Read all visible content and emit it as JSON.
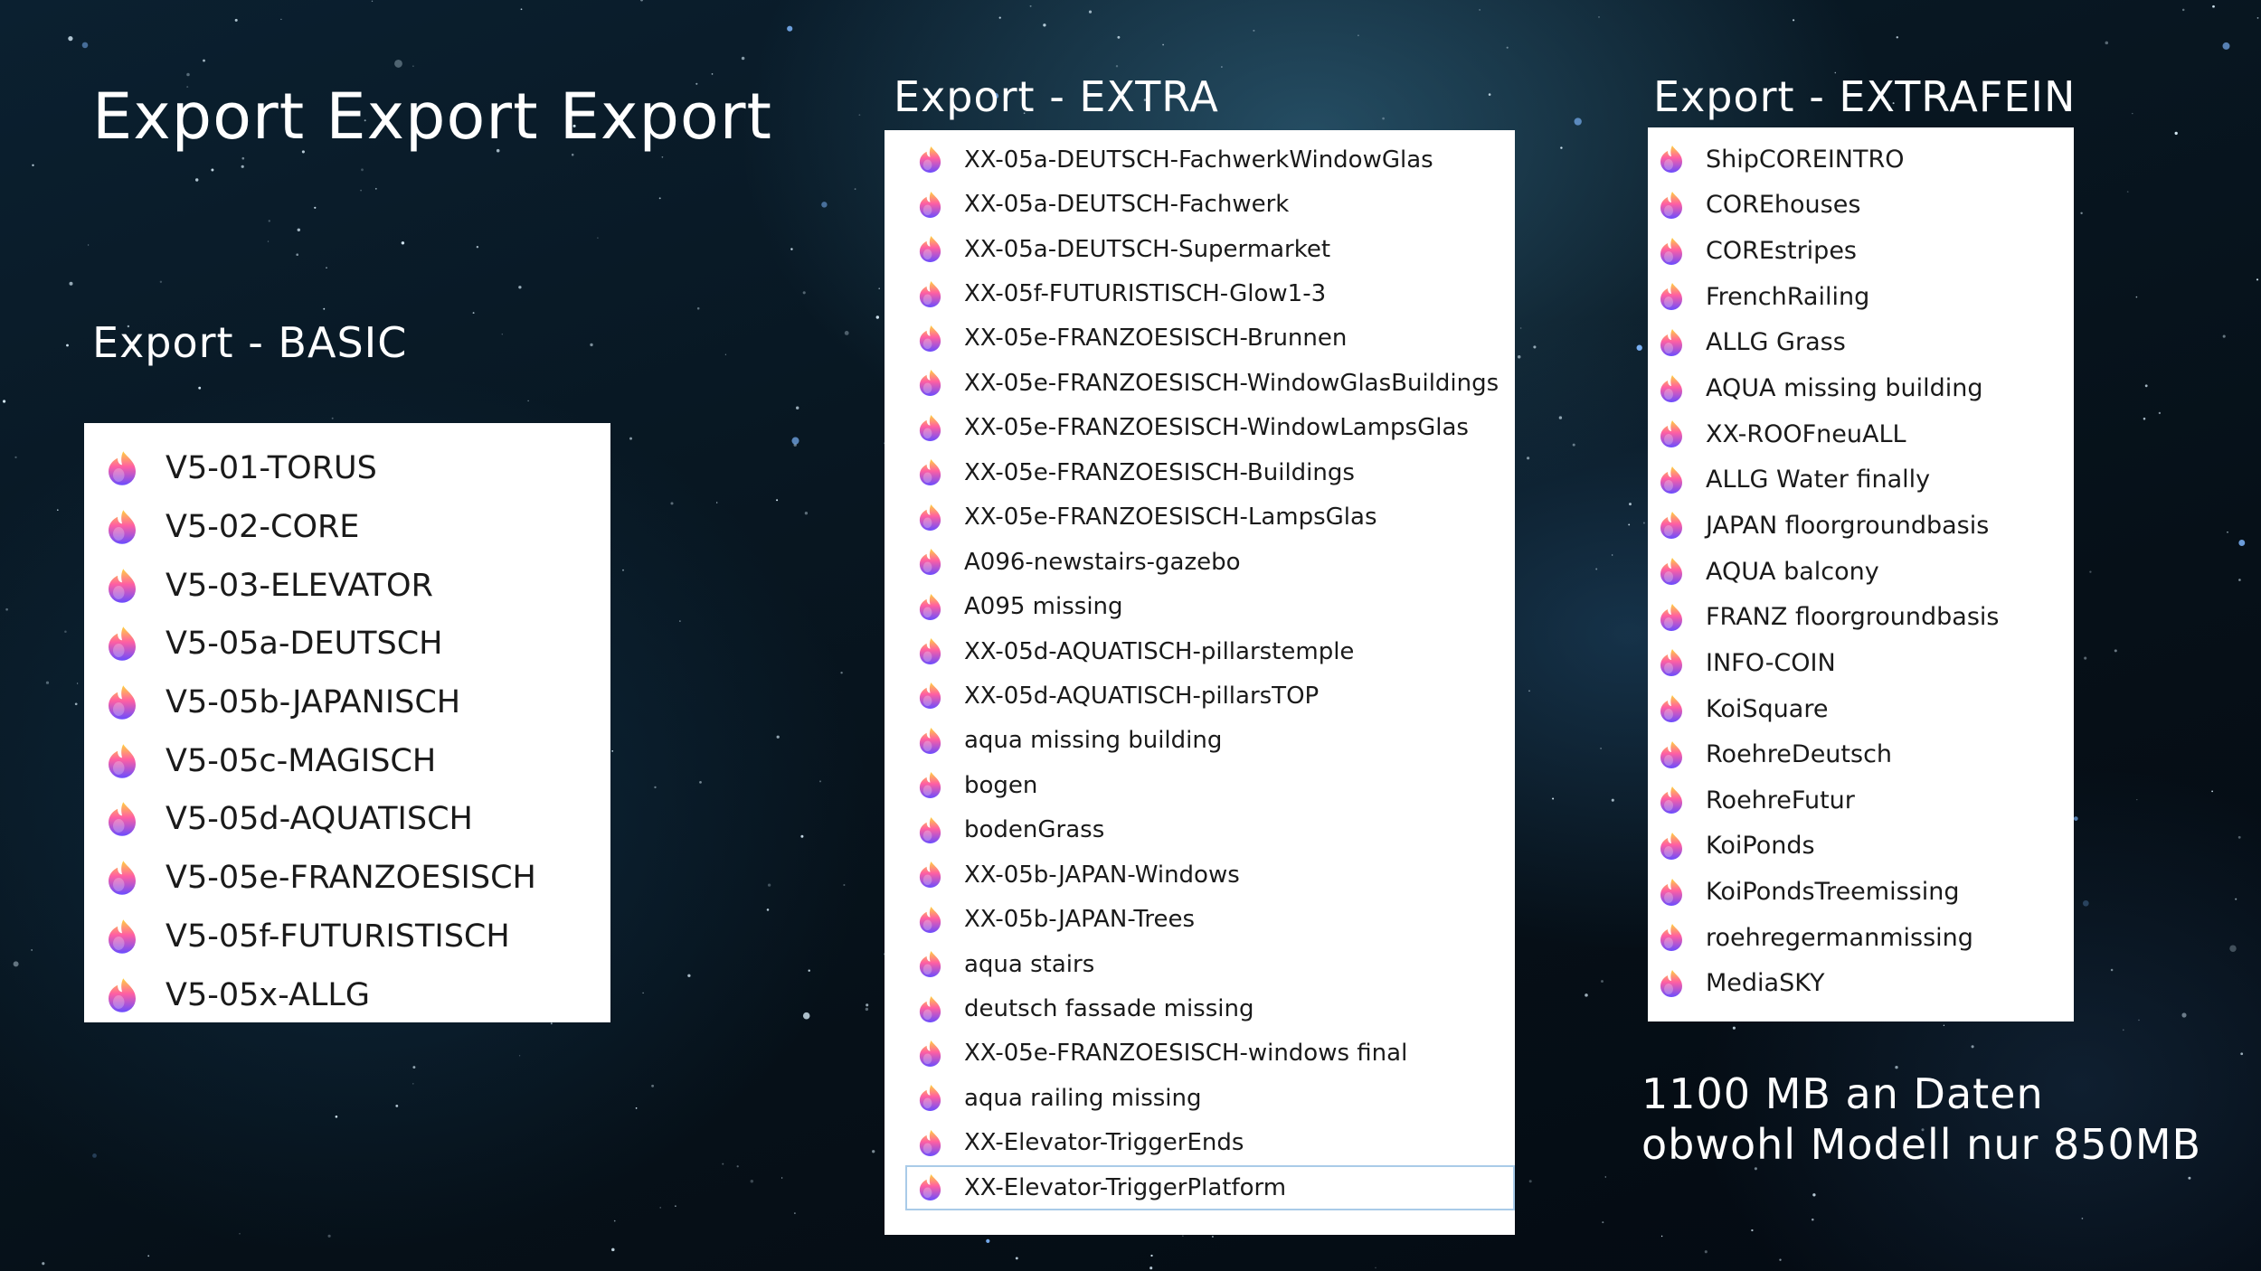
{
  "slide": {
    "title": "Export Export Export",
    "note_line1": "1100 MB an Daten",
    "note_line2": "obwohl Modell nur 850MB"
  },
  "colors": {
    "icon_top": "#ffd23f",
    "icon_mid": "#ff5fa2",
    "icon_bottom": "#6a4cff",
    "selection_border": "#a9cbe8"
  },
  "icon_name": "file-type-icon",
  "basic": {
    "title": "Export - BASIC",
    "items": [
      "V5-01-TORUS",
      "V5-02-CORE",
      "V5-03-ELEVATOR",
      "V5-05a-DEUTSCH",
      "V5-05b-JAPANISCH",
      "V5-05c-MAGISCH",
      "V5-05d-AQUATISCH",
      "V5-05e-FRANZOESISCH",
      "V5-05f-FUTURISTISCH",
      "V5-05x-ALLG"
    ]
  },
  "extra": {
    "title": "Export - EXTRA",
    "items": [
      "XX-05a-DEUTSCH-FachwerkWindowGlas",
      "XX-05a-DEUTSCH-Fachwerk",
      "XX-05a-DEUTSCH-Supermarket",
      "XX-05f-FUTURISTISCH-Glow1-3",
      "XX-05e-FRANZOESISCH-Brunnen",
      "XX-05e-FRANZOESISCH-WindowGlasBuildings",
      "XX-05e-FRANZOESISCH-WindowLampsGlas",
      "XX-05e-FRANZOESISCH-Buildings",
      "XX-05e-FRANZOESISCH-LampsGlas",
      "A096-newstairs-gazebo",
      "A095 missing",
      "XX-05d-AQUATISCH-pillarstemple",
      "XX-05d-AQUATISCH-pillarsTOP",
      "aqua missing building",
      "bogen",
      "bodenGrass",
      "XX-05b-JAPAN-Windows",
      "XX-05b-JAPAN-Trees",
      "aqua stairs",
      "deutsch fassade missing",
      "XX-05e-FRANZOESISCH-windows final",
      "aqua railing missing",
      "XX-Elevator-TriggerEnds",
      "XX-Elevator-TriggerPlatform"
    ]
  },
  "extrafein": {
    "title": "Export - EXTRAFEIN",
    "items": [
      "ShipCOREINTRO",
      "COREhouses",
      "COREstripes",
      "FrenchRailing",
      "ALLG Grass",
      "AQUA missing building",
      "XX-ROOFneuALL",
      "ALLG Water finally",
      "JAPAN floorgroundbasis",
      "AQUA balcony",
      "FRANZ floorgroundbasis",
      "INFO-COIN",
      "KoiSquare",
      "RoehreDeutsch",
      "RoehreFutur",
      "KoiPonds",
      "KoiPondsTreemissing",
      "roehregermanmissing",
      "MediaSKY"
    ]
  }
}
